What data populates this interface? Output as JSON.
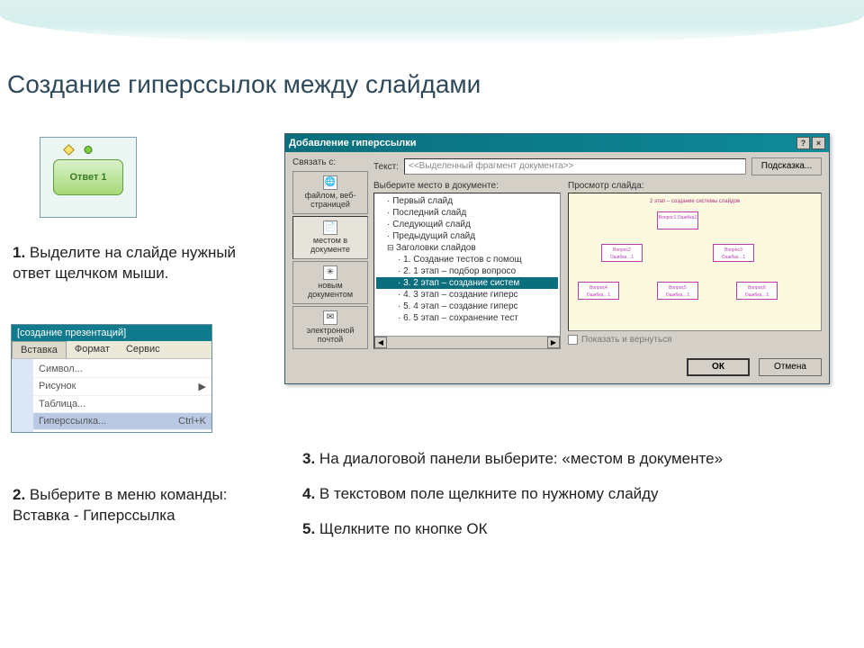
{
  "heading": "Создание гиперссылок между слайдами",
  "answer_label": "Ответ 1",
  "step1": {
    "n": "1.",
    "text": " Выделите на слайде нужный ответ щелчком мыши."
  },
  "step2": {
    "n": "2.",
    "text": " Выберите в меню команды:",
    "extra": "Вставка - Гиперссылка"
  },
  "step3": {
    "n": "3.",
    "text": " На диалоговой панели выберите: «местом в документе»"
  },
  "step4": {
    "n": "4.",
    "text": " В текстовом поле щелкните по нужному слайду"
  },
  "step5": {
    "n": "5.",
    "text": " Щелкните по кнопке ОК"
  },
  "menu": {
    "title": "[создание презентаций]",
    "tabs": [
      "Вставка",
      "Формат",
      "Сервис"
    ],
    "items": [
      {
        "label": "Символ...",
        "shortcut": ""
      },
      {
        "label": "Рисунок",
        "shortcut": "▶"
      },
      {
        "label": "Таблица...",
        "shortcut": ""
      },
      {
        "label": "Гиперссылка...",
        "shortcut": "Ctrl+K"
      }
    ]
  },
  "dialog": {
    "title": "Добавление гиперссылки",
    "link_label": "Связать с:",
    "text_label": "Текст:",
    "text_value": "<<Выделенный фрагмент документа>>",
    "tooltip_btn": "Подсказка...",
    "sidebar": [
      {
        "label": "файлом, веб-страницей"
      },
      {
        "label": "местом в документе"
      },
      {
        "label": "новым документом"
      },
      {
        "label": "электронной почтой"
      }
    ],
    "tree_label": "Выберите место в документе:",
    "preview_label": "Просмотр слайда:",
    "tree": [
      "Первый слайд",
      "Последний слайд",
      "Следующий слайд",
      "Предыдущий слайд"
    ],
    "tree_group": "Заголовки слайдов",
    "tree_children": [
      "1. Создание тестов с помощ",
      "2. 1 этап – подбор вопросо",
      "3. 2 этап – создание систем",
      "4. 3 этап – создание гиперс",
      "5. 4 этап – создание гиперс",
      "6. 5 этап – сохранение тест"
    ],
    "preview_title": "2 этап – создание системы слайдов",
    "show_return": "Показать и вернуться",
    "ok": "ОК",
    "cancel": "Отмена",
    "orgboxes": [
      "Вопрос1 Ошибка1",
      "Вопрос2 Ошибка→1",
      "Вопрос3 Ошибка→1",
      "Вопрос4 Ошибка→1",
      "Вопрос5 Ошибка→1",
      "Вопрос6 Ошибка→1"
    ]
  }
}
